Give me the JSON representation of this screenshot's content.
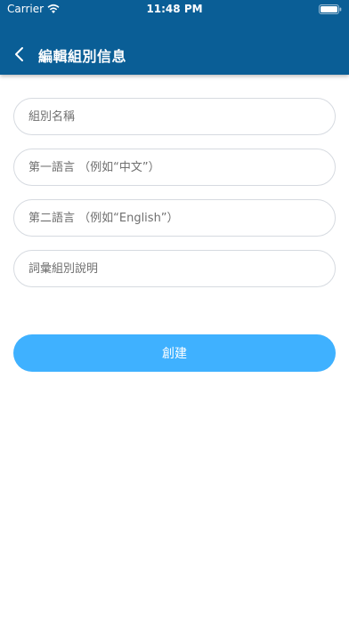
{
  "status_bar": {
    "carrier": "Carrier",
    "time": "11:48 PM"
  },
  "nav": {
    "title": "編輯組別信息"
  },
  "form": {
    "group_name_placeholder": "組別名稱",
    "first_language_placeholder": "第一語言 （例如“中文”）",
    "second_language_placeholder": "第二語言 （例如“English”）",
    "description_placeholder": "詞彙組別說明"
  },
  "actions": {
    "create_label": "創建"
  },
  "colors": {
    "header": "#0a5e96",
    "button": "#3fb1ff"
  }
}
